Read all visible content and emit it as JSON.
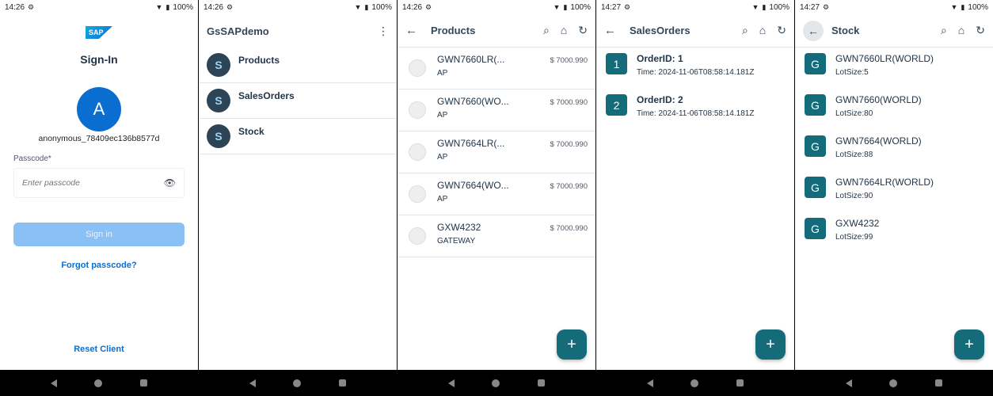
{
  "status": {
    "p1": {
      "time": "14:26",
      "battery": "100%"
    },
    "p2": {
      "time": "14:26",
      "battery": "100%"
    },
    "p3": {
      "time": "14:26",
      "battery": "100%"
    },
    "p4": {
      "time": "14:27",
      "battery": "100%"
    },
    "p5": {
      "time": "14:27",
      "battery": "100%"
    }
  },
  "signin": {
    "logo": "SAP",
    "title": "Sign-In",
    "avatar_letter": "A",
    "user_id": "anonymous_78409ec136b8577d",
    "passcode_label": "Passcode*",
    "passcode_placeholder": "Enter passcode",
    "signin_button": "Sign in",
    "forgot": "Forgot passcode?",
    "reset": "Reset Client"
  },
  "menu": {
    "title": "GsSAPdemo",
    "items": [
      {
        "label": "Products"
      },
      {
        "label": "SalesOrders"
      },
      {
        "label": "Stock"
      }
    ]
  },
  "products": {
    "title": "Products",
    "items": [
      {
        "name": "GWN7660LR(...",
        "sub": "AP",
        "price": "$ 7000.990"
      },
      {
        "name": "GWN7660(WO...",
        "sub": "AP",
        "price": "$ 7000.990"
      },
      {
        "name": "GWN7664LR(...",
        "sub": "AP",
        "price": "$ 7000.990"
      },
      {
        "name": "GWN7664(WO...",
        "sub": "AP",
        "price": "$ 7000.990"
      },
      {
        "name": "GXW4232",
        "sub": "GATEWAY",
        "price": "$ 7000.990"
      }
    ],
    "fab": "+"
  },
  "orders": {
    "title": "SalesOrders",
    "items": [
      {
        "badge": "1",
        "title": "OrderID: 1",
        "sub": "Time: 2024-11-06T08:58:14.181Z"
      },
      {
        "badge": "2",
        "title": "OrderID: 2",
        "sub": "Time: 2024-11-06T08:58:14.181Z"
      }
    ],
    "fab": "+"
  },
  "stock": {
    "title": "Stock",
    "items": [
      {
        "badge": "G",
        "title": "GWN7660LR(WORLD)",
        "sub": "LotSize:5"
      },
      {
        "badge": "G",
        "title": "GWN7660(WORLD)",
        "sub": "LotSize:80"
      },
      {
        "badge": "G",
        "title": "GWN7664(WORLD)",
        "sub": "LotSize:88"
      },
      {
        "badge": "G",
        "title": "GWN7664LR(WORLD)",
        "sub": "LotSize:90"
      },
      {
        "badge": "G",
        "title": "GXW4232",
        "sub": "LotSize:99"
      }
    ],
    "fab": "+"
  },
  "icons": {
    "settings": "⚙",
    "wifi": "▼",
    "battery": "▮",
    "back": "←",
    "search": "⌕",
    "home": "⌂",
    "refresh": "↻",
    "eye": "👁",
    "kebab": "⋮",
    "menu_glyph": "S"
  },
  "colors": {
    "brand_blue": "#0a6ed1",
    "teal": "#146b7a",
    "menu_icon_bg": "#2d4356"
  }
}
